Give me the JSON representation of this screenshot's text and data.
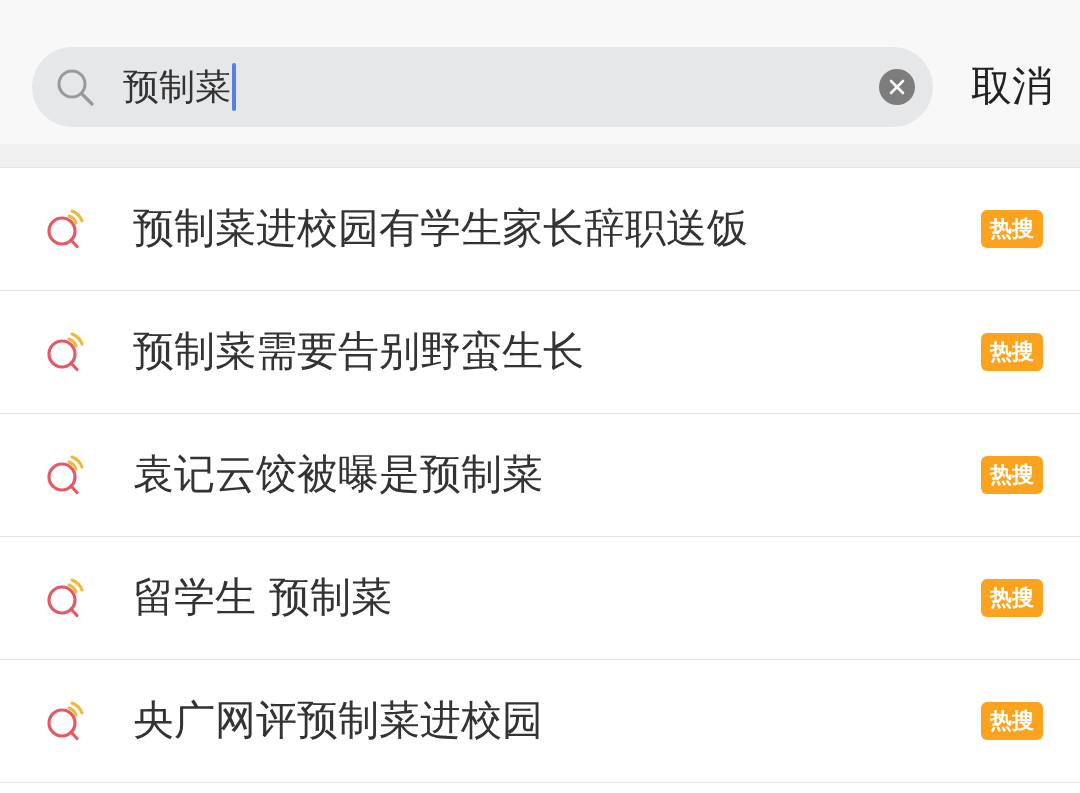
{
  "search": {
    "value": "预制菜",
    "focused": true,
    "cancel_label": "取消"
  },
  "suggestions": [
    {
      "text": "预制菜进校园有学生家长辞职送饭",
      "badge": "热搜"
    },
    {
      "text": "预制菜需要告别野蛮生长",
      "badge": "热搜"
    },
    {
      "text": "袁记云饺被曝是预制菜",
      "badge": "热搜"
    },
    {
      "text": "留学生 预制菜",
      "badge": "热搜"
    },
    {
      "text": "央广网评预制菜进校园",
      "badge": "热搜"
    }
  ]
}
